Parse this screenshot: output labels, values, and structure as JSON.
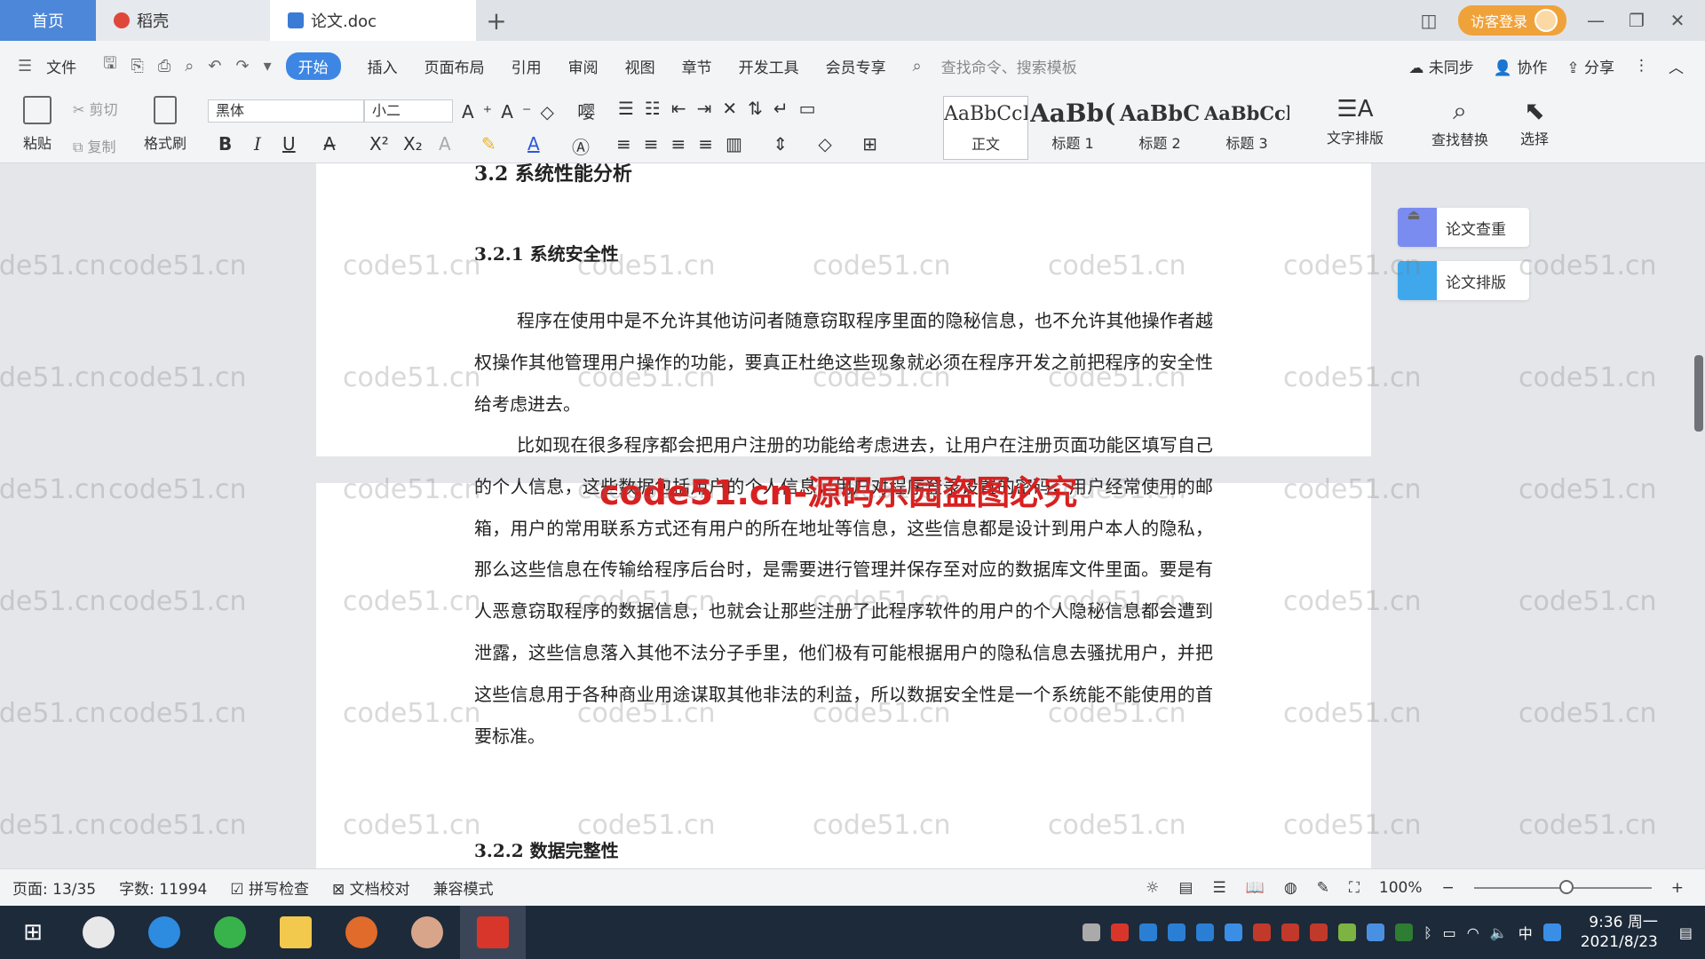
{
  "tabs": {
    "home": "首页",
    "daoke": "稻壳",
    "doc": "论文.doc",
    "new_tab": "+"
  },
  "titlebar": {
    "login": "访客登录"
  },
  "menu": {
    "file": "文件",
    "items": [
      "开始",
      "插入",
      "页面布局",
      "引用",
      "审阅",
      "视图",
      "章节",
      "开发工具",
      "会员专享"
    ],
    "search_placeholder": "查找命令、搜索模板",
    "sync": "未同步",
    "collab": "协作",
    "share": "分享"
  },
  "ribbon": {
    "paste": "粘贴",
    "cut": "剪切",
    "copy": "复制",
    "format_painter": "格式刷",
    "font_name": "黑体",
    "font_size": "小二",
    "styles": [
      {
        "preview": "AaBbCcI",
        "name": "正文"
      },
      {
        "preview": "AaBb(",
        "name": "标题 1"
      },
      {
        "preview": "AaBbC",
        "name": "标题 2"
      },
      {
        "preview": "AaBbCcl",
        "name": "标题 3"
      }
    ],
    "text_layout": "文字排版",
    "find_replace": "查找替换",
    "select": "选择"
  },
  "document": {
    "section_title": "3.2 系统性能分析",
    "sub1": "3.2.1  系统安全性",
    "para1": "程序在使用中是不允许其他访问者随意窃取程序里面的隐秘信息，也不允许其他操作者越权操作其他管理用户操作的功能，要真正杜绝这些现象就必须在程序开发之前把程序的安全性给考虑进去。",
    "para2": "比如现在很多程序都会把用户注册的功能给考虑进去，让用户在注册页面功能区填写自己的个人信息，这些数据包括用户的个人信息，用户对程序登录设置的密码，用户经常使用的邮箱，用户的常用联系方式还有用户的所在地址等信息，这些信息都是设计到用户本人的隐私，那么这些信息在传输给程序后台时，是需要进行管理并保存至对应的数据库文件里面。要是有人恶意窃取程序的数据信息，也就会让那些注册了此程序软件的用户的个人隐秘信息都会遭到泄露，这些信息落入其他不法分子手里，他们极有可能根据用户的隐私信息去骚扰用户，并把这些信息用于各种商业用途谋取其他非法的利益，所以数据安全性是一个系统能不能使用的首要标准。",
    "sub2": "3.2.2  数据完整性",
    "red_watermark": "code51.cn-源码乐园盗图必究",
    "tile_watermark": "code51.cn"
  },
  "side_panel": {
    "check": "论文查重",
    "layout": "论文排版"
  },
  "statusbar": {
    "page": "页面: 13/35",
    "words": "字数: 11994",
    "spell": "拼写检查",
    "proof": "文档校对",
    "compat": "兼容模式",
    "zoom": "100%"
  },
  "taskbar": {
    "time": "9:36 周一",
    "date": "2021/8/23",
    "ime": "中"
  },
  "colors": {
    "accent": "#3d86e4",
    "home_tab": "#4d87d9",
    "login": "#f0a23a",
    "watermark_red": "#d92020"
  }
}
